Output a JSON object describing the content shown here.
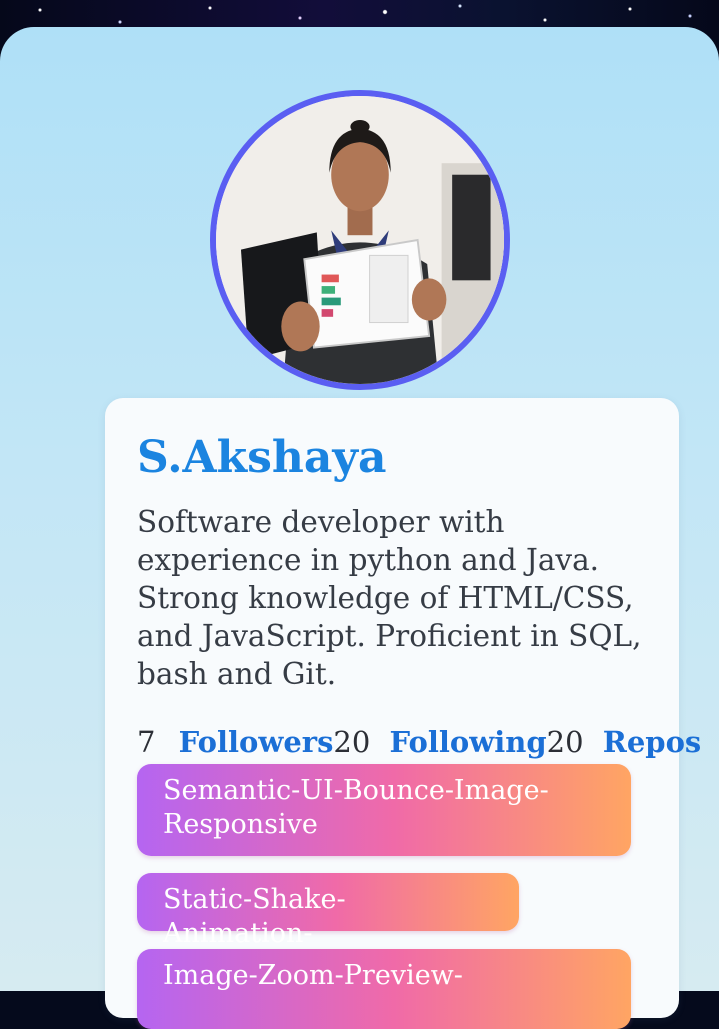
{
  "profile": {
    "name": "S.Akshaya",
    "bio": "Software developer with experience in python and Java. Strong knowledge of HTML/CSS, and JavaScript. Proficient in SQL, bash and Git."
  },
  "stats": {
    "followers_count": "7",
    "followers_label": "Followers",
    "following_count": "20",
    "following_label": "Following",
    "repos_count": "20",
    "repos_label": "Repos"
  },
  "repos": [
    {
      "name": "Semantic-UI-Bounce-Image-Responsive"
    },
    {
      "name": "Static-Shake-Animation-"
    },
    {
      "name": "Image-Zoom-Preview-"
    }
  ],
  "colors": {
    "accent": "#1b84e0",
    "avatar_ring": "#5a5ef2",
    "chip_gradient": [
      "#b565f1",
      "#f06aa8",
      "#ffa563"
    ]
  }
}
